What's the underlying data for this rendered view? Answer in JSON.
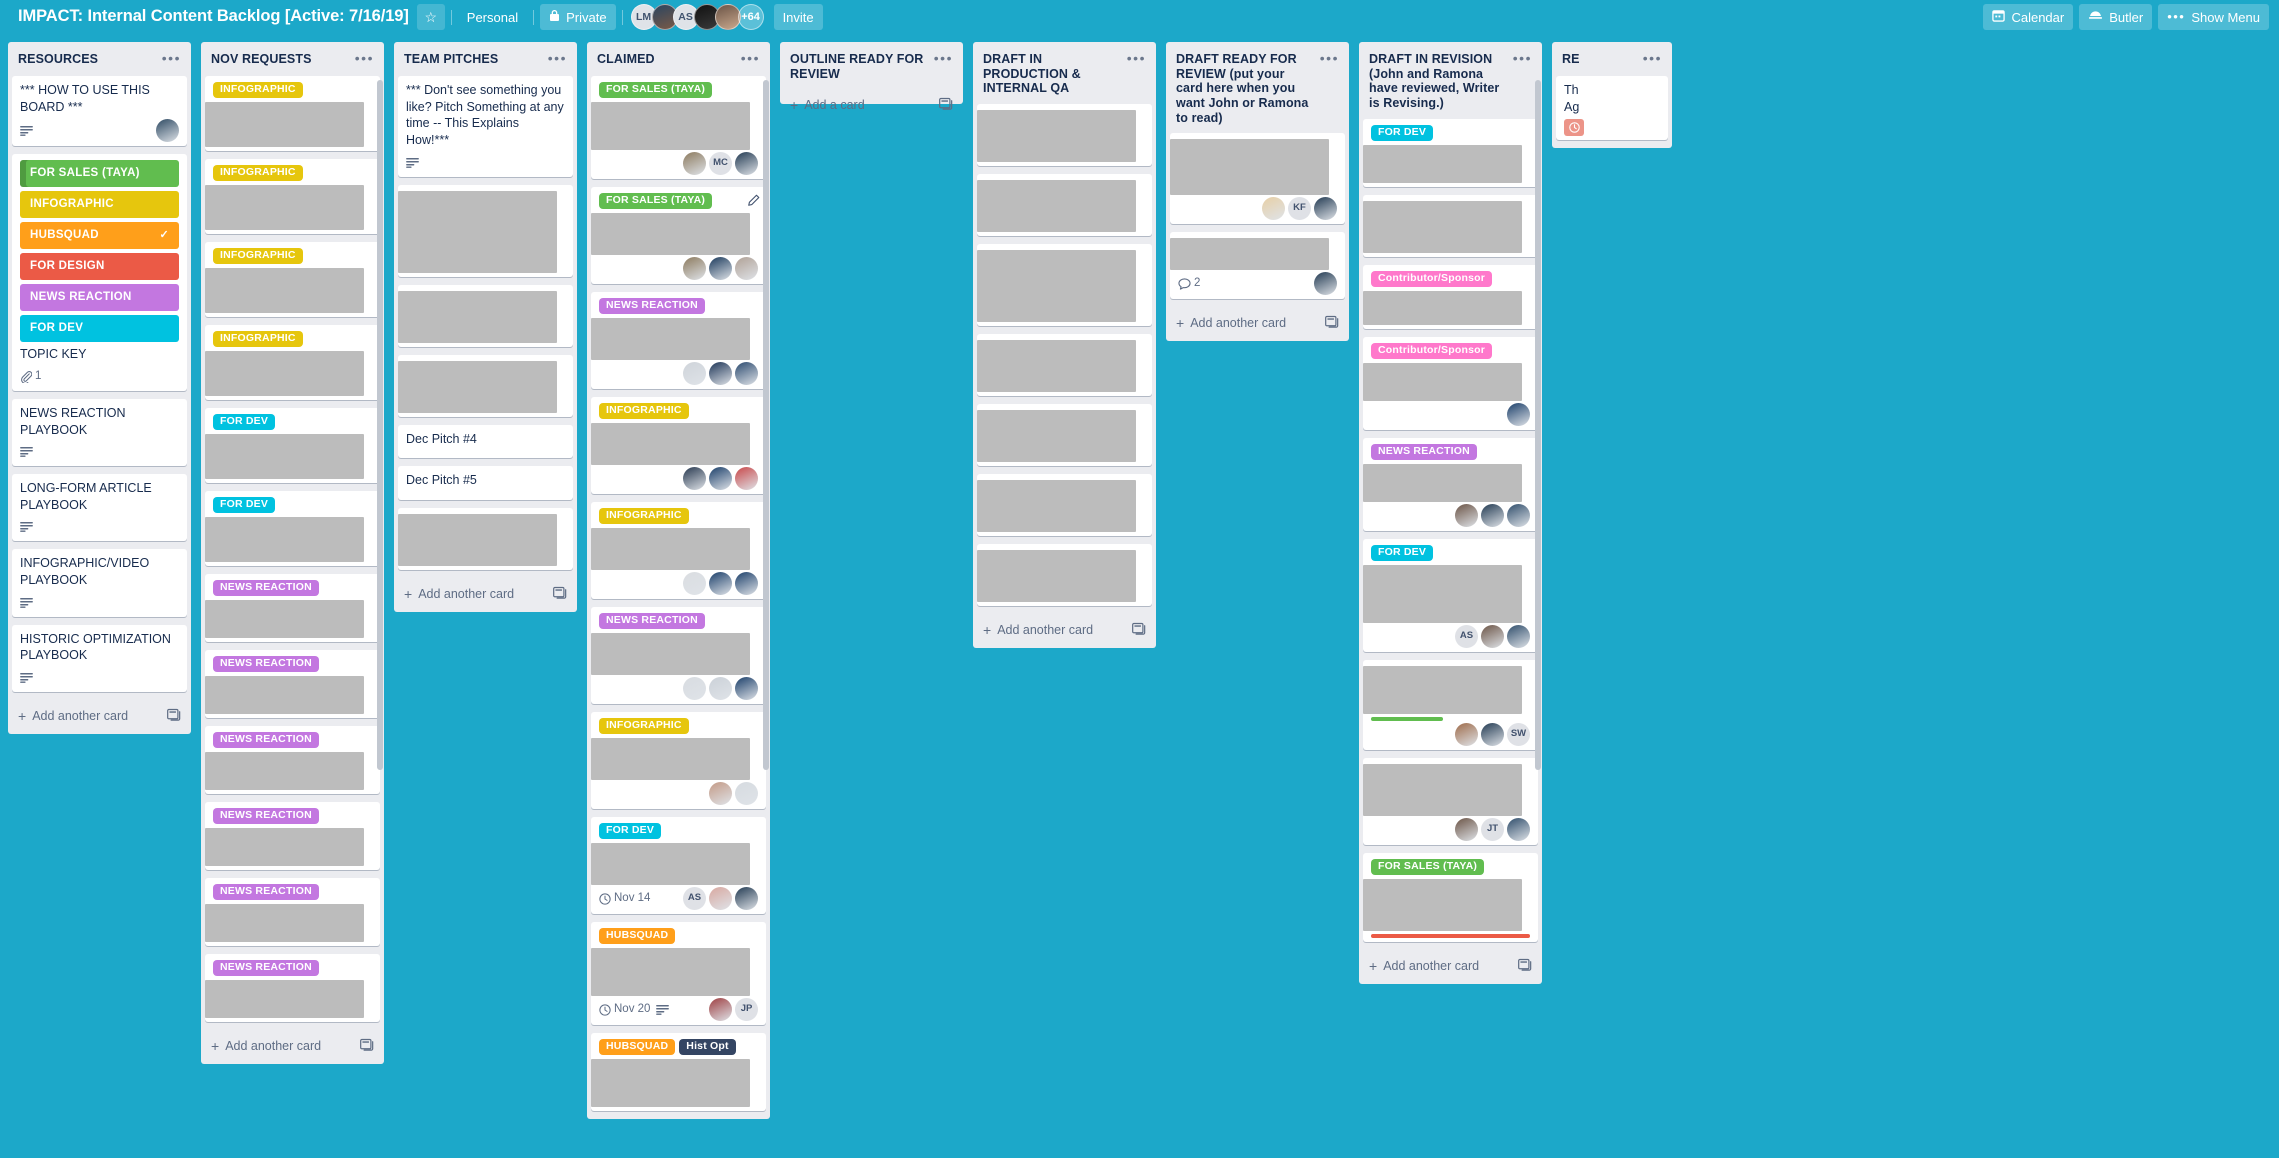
{
  "header": {
    "board_title": "IMPACT: Internal Content Backlog [Active: 7/16/19]",
    "star_icon": "star-icon",
    "team_label": "Personal",
    "visibility_label": "Private",
    "lock_icon": "lock-icon",
    "members": [
      {
        "initials": "LM",
        "type": "initials"
      },
      {
        "initials": "",
        "type": "photo",
        "color": "#1c3f5e"
      },
      {
        "initials": "AS",
        "type": "initials"
      },
      {
        "initials": "",
        "type": "photo",
        "color": "#0d0d0d"
      },
      {
        "initials": "",
        "type": "photo",
        "color": "#6b5446"
      }
    ],
    "more_members": "+64",
    "invite_label": "Invite",
    "calendar_label": "Calendar",
    "calendar_icon": "calendar-icon",
    "butler_label": "Butler",
    "butler_icon": "butler-robot-icon",
    "show_menu_label": "Show Menu",
    "show_menu_icon": "ellipsis-icon"
  },
  "label_colors": {
    "green": "#61bd4f",
    "yellow": "#e6c60d",
    "orange": "#ff9f1a",
    "red": "#eb5a46",
    "purple": "#c377e0",
    "sky": "#00c2e0",
    "pink": "#ff78cb",
    "navy": "#344563",
    "lime": "#51e898"
  },
  "lists": [
    {
      "title": "RESOURCES",
      "add_card_label": "Add another card",
      "cards": [
        {
          "kind": "text",
          "title": "*** HOW TO USE THIS BOARD ***",
          "badges": {
            "description": true
          },
          "members": [
            {
              "type": "photo",
              "color": "#2e4a63"
            }
          ]
        },
        {
          "kind": "legend",
          "title": "TOPIC KEY",
          "label_blocks": [
            {
              "text": "FOR SALES (TAYA)",
              "color": "green",
              "checked": false,
              "covered": true
            },
            {
              "text": "INFOGRAPHIC",
              "color": "yellow",
              "checked": false
            },
            {
              "text": "HUBSQUAD",
              "color": "orange",
              "checked": true
            },
            {
              "text": "FOR DESIGN",
              "color": "red",
              "checked": false
            },
            {
              "text": "NEWS REACTION",
              "color": "purple",
              "checked": false
            },
            {
              "text": "FOR DEV",
              "color": "sky",
              "checked": false
            }
          ],
          "badges": {
            "attachments": "1"
          }
        },
        {
          "kind": "text",
          "title": "NEWS REACTION PLAYBOOK",
          "badges": {
            "description": true
          }
        },
        {
          "kind": "text",
          "title": "LONG-FORM ARTICLE PLAYBOOK",
          "badges": {
            "description": true
          }
        },
        {
          "kind": "text",
          "title": "INFOGRAPHIC/VIDEO PLAYBOOK",
          "badges": {
            "description": true
          }
        },
        {
          "kind": "text",
          "title": "HISTORIC OPTIMIZATION PLAYBOOK",
          "badges": {
            "description": true
          }
        }
      ]
    },
    {
      "title": "NOV REQUESTS",
      "add_card_label": "Add another card",
      "scroll": true,
      "cards": [
        {
          "kind": "redacted",
          "labels": [
            {
              "text": "INFOGRAPHIC",
              "color": "yellow"
            }
          ],
          "body_h": 45
        },
        {
          "kind": "redacted",
          "labels": [
            {
              "text": "INFOGRAPHIC",
              "color": "yellow"
            }
          ],
          "body_h": 45
        },
        {
          "kind": "redacted",
          "labels": [
            {
              "text": "INFOGRAPHIC",
              "color": "yellow"
            }
          ],
          "body_h": 45
        },
        {
          "kind": "redacted",
          "labels": [
            {
              "text": "INFOGRAPHIC",
              "color": "yellow"
            }
          ],
          "body_h": 45
        },
        {
          "kind": "redacted",
          "labels": [
            {
              "text": "FOR DEV",
              "color": "sky"
            }
          ],
          "body_h": 45
        },
        {
          "kind": "redacted",
          "labels": [
            {
              "text": "FOR DEV",
              "color": "sky"
            }
          ],
          "body_h": 45
        },
        {
          "kind": "redacted",
          "labels": [
            {
              "text": "NEWS REACTION",
              "color": "purple"
            }
          ],
          "body_h": 38
        },
        {
          "kind": "redacted",
          "labels": [
            {
              "text": "NEWS REACTION",
              "color": "purple"
            }
          ],
          "body_h": 38
        },
        {
          "kind": "redacted",
          "labels": [
            {
              "text": "NEWS REACTION",
              "color": "purple"
            }
          ],
          "body_h": 38
        },
        {
          "kind": "redacted",
          "labels": [
            {
              "text": "NEWS REACTION",
              "color": "purple"
            }
          ],
          "body_h": 38
        },
        {
          "kind": "redacted",
          "labels": [
            {
              "text": "NEWS REACTION",
              "color": "purple"
            }
          ],
          "body_h": 38
        },
        {
          "kind": "redacted",
          "labels": [
            {
              "text": "NEWS REACTION",
              "color": "purple"
            }
          ],
          "body_h": 38
        }
      ]
    },
    {
      "title": "TEAM PITCHES",
      "add_card_label": "Add another card",
      "cards": [
        {
          "kind": "text",
          "title": "*** Don't see something you like? Pitch Something at any time -- This Explains How!***",
          "badges": {
            "description": true
          }
        },
        {
          "kind": "redacted",
          "body_h": 82
        },
        {
          "kind": "redacted",
          "body_h": 52
        },
        {
          "kind": "redacted",
          "body_h": 52
        },
        {
          "kind": "plain",
          "title": "Dec Pitch #4"
        },
        {
          "kind": "plain",
          "title": "Dec Pitch #5"
        },
        {
          "kind": "redacted",
          "body_h": 52
        }
      ]
    },
    {
      "title": "CLAIMED",
      "scroll": true,
      "cards": [
        {
          "kind": "redacted",
          "labels": [
            {
              "text": "FOR SALES (TAYA)",
              "color": "green"
            }
          ],
          "body_h": 48,
          "members": [
            {
              "type": "photo",
              "color": "#8c7a5e"
            },
            {
              "type": "initials",
              "initials": "MC"
            },
            {
              "type": "photo",
              "color": "#223a52"
            }
          ]
        },
        {
          "kind": "redacted",
          "labels": [
            {
              "text": "FOR SALES (TAYA)",
              "color": "green"
            }
          ],
          "edit_icon": true,
          "body_h": 42,
          "members": [
            {
              "type": "photo",
              "color": "#8c7a5e"
            },
            {
              "type": "photo",
              "color": "#1b3a5c"
            },
            {
              "type": "photo",
              "color": "#b0a196"
            }
          ]
        },
        {
          "kind": "redacted",
          "labels": [
            {
              "text": "NEWS REACTION",
              "color": "purple"
            }
          ],
          "body_h": 42,
          "members": [
            {
              "type": "photo",
              "color": "#cfd4da"
            },
            {
              "type": "photo",
              "color": "#1d3557"
            },
            {
              "type": "photo",
              "color": "#2b4a6f"
            }
          ]
        },
        {
          "kind": "redacted",
          "labels": [
            {
              "text": "INFOGRAPHIC",
              "color": "yellow"
            }
          ],
          "body_h": 42,
          "members": [
            {
              "type": "photo",
              "color": "#27384f"
            },
            {
              "type": "photo",
              "color": "#1b3f6a"
            },
            {
              "type": "photo",
              "color": "#c8484a"
            }
          ]
        },
        {
          "kind": "redacted",
          "labels": [
            {
              "text": "INFOGRAPHIC",
              "color": "yellow"
            }
          ],
          "body_h": 42,
          "members": [
            {
              "type": "photo",
              "color": "#dadde1"
            },
            {
              "type": "photo",
              "color": "#1b3f6a"
            },
            {
              "type": "photo",
              "color": "#1b3f6a"
            }
          ]
        },
        {
          "kind": "redacted",
          "labels": [
            {
              "text": "NEWS REACTION",
              "color": "purple"
            }
          ],
          "body_h": 42,
          "members": [
            {
              "type": "photo",
              "color": "#d8dce1"
            },
            {
              "type": "photo",
              "color": "#cbd1d8"
            },
            {
              "type": "photo",
              "color": "#1b3f6a"
            }
          ]
        },
        {
          "kind": "redacted",
          "labels": [
            {
              "text": "INFOGRAPHIC",
              "color": "yellow"
            }
          ],
          "body_h": 42,
          "members": [
            {
              "type": "photo",
              "color": "#c39a86"
            },
            {
              "type": "photo",
              "color": "#d6dbe0"
            }
          ]
        },
        {
          "kind": "redacted",
          "labels": [
            {
              "text": "FOR DEV",
              "color": "sky"
            }
          ],
          "body_h": 42,
          "due": "Nov 14",
          "members": [
            {
              "type": "initials",
              "initials": "AS"
            },
            {
              "type": "photo",
              "color": "#d8a8a0"
            },
            {
              "type": "photo",
              "color": "#223a52"
            }
          ]
        },
        {
          "kind": "redacted",
          "labels": [
            {
              "text": "HUBSQUAD",
              "color": "orange"
            }
          ],
          "body_h": 48,
          "due": "Nov 20",
          "desc": true,
          "members": [
            {
              "type": "photo",
              "color": "#9e3f42"
            },
            {
              "type": "initials",
              "initials": "JP"
            }
          ]
        },
        {
          "kind": "redacted",
          "labels": [
            {
              "text": "HUBSQUAD",
              "color": "orange"
            },
            {
              "text": "Hist Opt",
              "color": "navy"
            }
          ],
          "body_h": 48
        }
      ]
    },
    {
      "title": "OUTLINE READY FOR REVIEW",
      "add_card_label": "Add a card",
      "empty": true,
      "cards": []
    },
    {
      "title": "DRAFT IN PRODUCTION & INTERNAL QA",
      "add_card_label": "Add another card",
      "cards": [
        {
          "kind": "redacted",
          "body_h": 52
        },
        {
          "kind": "redacted",
          "body_h": 52
        },
        {
          "kind": "redacted",
          "body_h": 72
        },
        {
          "kind": "redacted",
          "body_h": 52
        },
        {
          "kind": "redacted",
          "body_h": 52
        },
        {
          "kind": "redacted",
          "body_h": 52
        },
        {
          "kind": "redacted",
          "body_h": 52
        }
      ]
    },
    {
      "title": "DRAFT READY FOR REVIEW (put your card here when you want John or Ramona to read)",
      "add_card_label": "Add another card",
      "cards": [
        {
          "kind": "redacted",
          "body_h": 56,
          "members": [
            {
              "type": "photo",
              "color": "#e7cfa6"
            },
            {
              "type": "initials",
              "initials": "KF"
            },
            {
              "type": "photo",
              "color": "#223a52"
            }
          ]
        },
        {
          "kind": "redacted",
          "body_h": 32,
          "comments": "2",
          "members": [
            {
              "type": "photo",
              "color": "#223a52"
            }
          ]
        }
      ]
    },
    {
      "title": "DRAFT IN REVISION (John and Ramona have reviewed, Writer is Revising.)",
      "add_card_label": "Add another card",
      "scroll": true,
      "cards": [
        {
          "kind": "redacted",
          "labels": [
            {
              "text": "FOR DEV",
              "color": "sky"
            }
          ],
          "body_h": 38
        },
        {
          "kind": "redacted",
          "body_h": 52
        },
        {
          "kind": "redacted",
          "labels": [
            {
              "text": "Contributor/Sponsor",
              "color": "pink"
            }
          ],
          "body_h": 34
        },
        {
          "kind": "redacted",
          "labels": [
            {
              "text": "Contributor/Sponsor",
              "color": "pink"
            }
          ],
          "body_h": 38,
          "members": [
            {
              "type": "photo",
              "color": "#1b3f6a"
            }
          ]
        },
        {
          "kind": "redacted",
          "labels": [
            {
              "text": "NEWS REACTION",
              "color": "purple"
            }
          ],
          "body_h": 38,
          "members": [
            {
              "type": "photo",
              "color": "#6b5446"
            },
            {
              "type": "photo",
              "color": "#223a52"
            },
            {
              "type": "photo",
              "color": "#2f4d6b"
            }
          ]
        },
        {
          "kind": "redacted",
          "labels": [
            {
              "text": "FOR DEV",
              "color": "sky"
            }
          ],
          "body_h": 58,
          "members": [
            {
              "type": "initials",
              "initials": "AS"
            },
            {
              "type": "photo",
              "color": "#6b5446"
            },
            {
              "type": "photo",
              "color": "#2f4d6b"
            }
          ]
        },
        {
          "kind": "redacted",
          "body_h": 48,
          "progress_bar": true,
          "members": [
            {
              "type": "photo",
              "color": "#9e6b4a"
            },
            {
              "type": "photo",
              "color": "#223a52"
            },
            {
              "type": "initials",
              "initials": "SW"
            }
          ]
        },
        {
          "kind": "redacted",
          "body_h": 52,
          "members": [
            {
              "type": "photo",
              "color": "#6b5446"
            },
            {
              "type": "initials",
              "initials": "JT"
            },
            {
              "type": "photo",
              "color": "#2f4d6b"
            }
          ]
        },
        {
          "kind": "redacted",
          "labels": [
            {
              "text": "FOR SALES (TAYA)",
              "color": "green"
            }
          ],
          "body_h": 52,
          "red_bar": true
        }
      ]
    },
    {
      "title": "RE",
      "partial": true,
      "add_card_label": "",
      "cards": [
        {
          "kind": "partial",
          "line1": "Th",
          "line2": "Ag",
          "due_icon": true
        }
      ]
    }
  ]
}
